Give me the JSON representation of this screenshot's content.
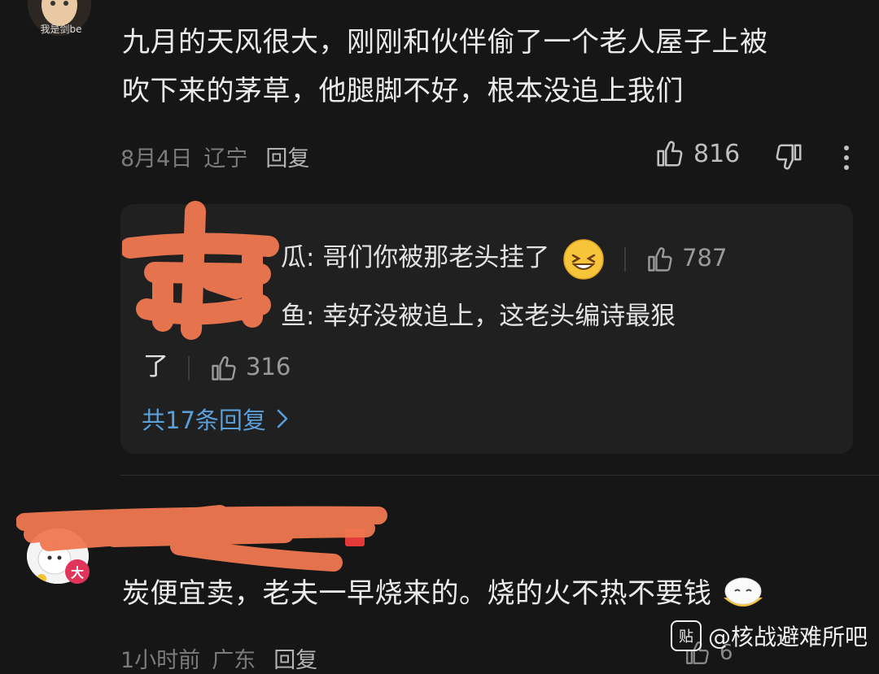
{
  "comment1": {
    "avatar_caption": "我是剑be",
    "text_line1": "九月的天风很大，刚刚和伙伴偷了一个老人屋子上被",
    "text_line2": "吹下来的茅草，他腿脚不好，根本没追上我们",
    "date": "8月4日",
    "location": "辽宁",
    "reply_label": "回复",
    "likes": "816"
  },
  "replies": {
    "items": [
      {
        "name_fragment": "瓜:",
        "text": "哥们你被那老头挂了",
        "likes": "787",
        "emoji": "grinning-squint-face-icon"
      },
      {
        "name_fragment": "鱼:",
        "text_line1": "幸好没被追上，这老头编诗最狠",
        "text_line2": "了",
        "likes": "316"
      }
    ],
    "more_label": "共17条回复"
  },
  "comment2": {
    "badge": "大",
    "text": "炭便宜卖，老夫一早烧来的。烧的火不热不要钱",
    "emoji": "steamed-bun-emoji-icon",
    "time": "1小时前",
    "location": "广东",
    "reply_label": "回复",
    "likes_partial": "6"
  },
  "watermark": {
    "badge": "贴",
    "text": "@核战避难所吧"
  },
  "colors": {
    "background": "#161616",
    "reply_box": "#202020",
    "link_blue": "#5a9fd8",
    "redaction": "#f07850"
  }
}
